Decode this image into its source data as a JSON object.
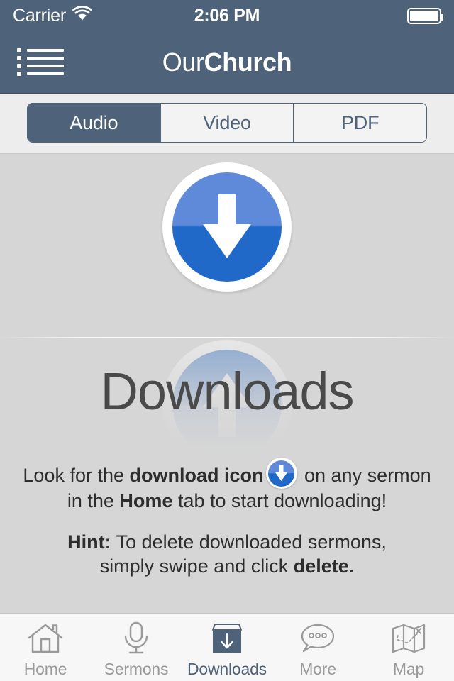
{
  "status_bar": {
    "carrier": "Carrier",
    "wifi_icon": "wifi-icon",
    "time": "2:06 PM",
    "battery_icon": "battery-full-icon"
  },
  "nav_bar": {
    "menu_icon": "list-menu-icon",
    "title_light": "Our",
    "title_bold": "Church"
  },
  "segmented_control": {
    "selected": "Audio",
    "options": [
      {
        "label": "Audio",
        "active": true
      },
      {
        "label": "Video",
        "active": false
      },
      {
        "label": "PDF",
        "active": false
      }
    ]
  },
  "main": {
    "hero_icon": "download-circle-icon",
    "page_title": "Downloads",
    "instruction": {
      "line1_a": "Look for the ",
      "line1_bold": "download icon",
      "inline_icon": "download-circle-icon",
      "line1_b": " on any sermon",
      "line2_a": "in the ",
      "line2_bold": "Home",
      "line2_b": " tab to start downloading!"
    },
    "hint": {
      "label": "Hint:",
      "line1": " To delete downloaded sermons,",
      "line2_a": "simply swipe and click ",
      "line2_bold": "delete."
    }
  },
  "tab_bar": {
    "items": [
      {
        "label": "Home",
        "icon": "house-icon",
        "active": false
      },
      {
        "label": "Sermons",
        "icon": "microphone-icon",
        "active": false
      },
      {
        "label": "Downloads",
        "icon": "download-box-icon",
        "active": true
      },
      {
        "label": "More",
        "icon": "speech-bubble-icon",
        "active": false
      },
      {
        "label": "Map",
        "icon": "folded-map-icon",
        "active": false
      }
    ]
  },
  "colors": {
    "brand": "#4e6279",
    "accent_blue_top": "#5f8ada",
    "accent_blue_bottom": "#2169c9",
    "background": "#d6d6d6",
    "tab_inactive": "#9a9a9a"
  }
}
